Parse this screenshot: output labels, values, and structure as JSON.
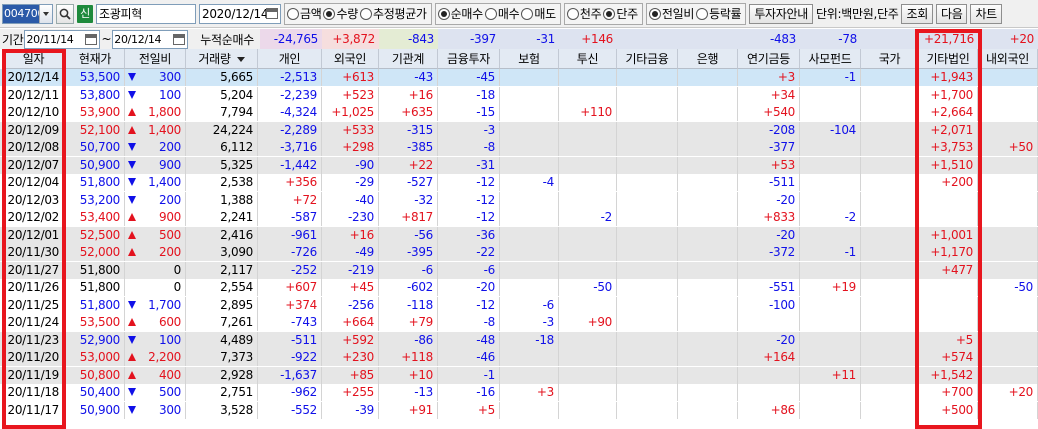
{
  "toolbar": {
    "stock_code": "004700",
    "market_badge": "신",
    "stock_name": "조광피혁",
    "date": "2020/12/14",
    "value_type": {
      "options": [
        "금액",
        "수량",
        "추정평균가"
      ],
      "selected": "수량"
    },
    "trade_type": {
      "options": [
        "순매수",
        "매수",
        "매도"
      ],
      "selected": "순매수"
    },
    "price_unit": {
      "options": [
        "천주",
        "단주"
      ],
      "selected": "단주"
    },
    "compare": {
      "options": [
        "전일비",
        "등락률"
      ],
      "selected": "전일비"
    },
    "investor_guide_label": "투자자안내",
    "unit_text": "단위:백만원,단주",
    "search_label": "조회",
    "next_label": "다음",
    "chart_label": "차트"
  },
  "filter": {
    "period_label": "기간",
    "from_date": "20/11/14",
    "tilde": "~",
    "to_date": "20/12/14",
    "cumulative_label": "누적순매수"
  },
  "cumulative": [
    "-24,765",
    "+3,872",
    "-843",
    "-397",
    "-31",
    "+146",
    "",
    "",
    "-483",
    "-78",
    "",
    "+21,716",
    "+20"
  ],
  "headers": [
    "일자",
    "현재가",
    "전일비",
    "거래량",
    "개인",
    "외국인",
    "기관계",
    "금융투자",
    "보험",
    "투신",
    "기타금융",
    "은행",
    "연기금등",
    "사모펀드",
    "국가",
    "기타법인",
    "내외국인"
  ],
  "rows": [
    {
      "date": "20/12/14",
      "price": "53,500",
      "dir": "down",
      "change": "300",
      "volume": "5,665",
      "vals": [
        "-2,513",
        "+613",
        "-43",
        "-45",
        "",
        "",
        "",
        "",
        "+3",
        "-1",
        "",
        "+1,943",
        ""
      ]
    },
    {
      "date": "20/12/11",
      "price": "53,800",
      "dir": "down",
      "change": "100",
      "volume": "5,204",
      "vals": [
        "-2,239",
        "+523",
        "+16",
        "-18",
        "",
        "",
        "",
        "",
        "+34",
        "",
        "",
        "+1,700",
        ""
      ]
    },
    {
      "date": "20/12/10",
      "price": "53,900",
      "dir": "up",
      "change": "1,800",
      "volume": "7,794",
      "vals": [
        "-4,324",
        "+1,025",
        "+635",
        "-15",
        "",
        "+110",
        "",
        "",
        "+540",
        "",
        "",
        "+2,664",
        ""
      ]
    },
    {
      "date": "20/12/09",
      "price": "52,100",
      "dir": "up",
      "change": "1,400",
      "volume": "24,224",
      "vals": [
        "-2,289",
        "+533",
        "-315",
        "-3",
        "",
        "",
        "",
        "",
        "-208",
        "-104",
        "",
        "+2,071",
        ""
      ]
    },
    {
      "date": "20/12/08",
      "price": "50,700",
      "dir": "down",
      "change": "200",
      "volume": "6,112",
      "vals": [
        "-3,716",
        "+298",
        "-385",
        "-8",
        "",
        "",
        "",
        "",
        "-377",
        "",
        "",
        "+3,753",
        "+50"
      ]
    },
    {
      "date": "20/12/07",
      "price": "50,900",
      "dir": "down",
      "change": "900",
      "volume": "5,325",
      "vals": [
        "-1,442",
        "-90",
        "+22",
        "-31",
        "",
        "",
        "",
        "",
        "+53",
        "",
        "",
        "+1,510",
        ""
      ]
    },
    {
      "date": "20/12/04",
      "price": "51,800",
      "dir": "down",
      "change": "1,400",
      "volume": "2,538",
      "vals": [
        "+356",
        "-29",
        "-527",
        "-12",
        "-4",
        "",
        "",
        "",
        "-511",
        "",
        "",
        "+200",
        ""
      ]
    },
    {
      "date": "20/12/03",
      "price": "53,200",
      "dir": "down",
      "change": "200",
      "volume": "1,388",
      "vals": [
        "+72",
        "-40",
        "-32",
        "-12",
        "",
        "",
        "",
        "",
        "-20",
        "",
        "",
        "",
        ""
      ]
    },
    {
      "date": "20/12/02",
      "price": "53,400",
      "dir": "up",
      "change": "900",
      "volume": "2,241",
      "vals": [
        "-587",
        "-230",
        "+817",
        "-12",
        "",
        "-2",
        "",
        "",
        "+833",
        "-2",
        "",
        "",
        ""
      ]
    },
    {
      "date": "20/12/01",
      "price": "52,500",
      "dir": "up",
      "change": "500",
      "volume": "2,416",
      "vals": [
        "-961",
        "+16",
        "-56",
        "-36",
        "",
        "",
        "",
        "",
        "-20",
        "",
        "",
        "+1,001",
        ""
      ]
    },
    {
      "date": "20/11/30",
      "price": "52,000",
      "dir": "up",
      "change": "200",
      "volume": "3,090",
      "vals": [
        "-726",
        "-49",
        "-395",
        "-22",
        "",
        "",
        "",
        "",
        "-372",
        "-1",
        "",
        "+1,170",
        ""
      ]
    },
    {
      "date": "20/11/27",
      "price": "51,800",
      "dir": "",
      "change": "0",
      "volume": "2,117",
      "vals": [
        "-252",
        "-219",
        "-6",
        "-6",
        "",
        "",
        "",
        "",
        "",
        "",
        "",
        "+477",
        ""
      ]
    },
    {
      "date": "20/11/26",
      "price": "51,800",
      "dir": "",
      "change": "0",
      "volume": "2,554",
      "vals": [
        "+607",
        "+45",
        "-602",
        "-20",
        "",
        "-50",
        "",
        "",
        "-551",
        "+19",
        "",
        "",
        "-50"
      ]
    },
    {
      "date": "20/11/25",
      "price": "51,800",
      "dir": "down",
      "change": "1,700",
      "volume": "2,895",
      "vals": [
        "+374",
        "-256",
        "-118",
        "-12",
        "-6",
        "",
        "",
        "",
        "-100",
        "",
        "",
        "",
        ""
      ]
    },
    {
      "date": "20/11/24",
      "price": "53,500",
      "dir": "up",
      "change": "600",
      "volume": "7,261",
      "vals": [
        "-743",
        "+664",
        "+79",
        "-8",
        "-3",
        "+90",
        "",
        "",
        "",
        "",
        "",
        "",
        ""
      ]
    },
    {
      "date": "20/11/23",
      "price": "52,900",
      "dir": "down",
      "change": "100",
      "volume": "4,489",
      "vals": [
        "-511",
        "+592",
        "-86",
        "-48",
        "-18",
        "",
        "",
        "",
        "-20",
        "",
        "",
        "+5",
        ""
      ]
    },
    {
      "date": "20/11/20",
      "price": "53,000",
      "dir": "up",
      "change": "2,200",
      "volume": "7,373",
      "vals": [
        "-922",
        "+230",
        "+118",
        "-46",
        "",
        "",
        "",
        "",
        "+164",
        "",
        "",
        "+574",
        ""
      ]
    },
    {
      "date": "20/11/19",
      "price": "50,800",
      "dir": "up",
      "change": "400",
      "volume": "2,928",
      "vals": [
        "-1,637",
        "+85",
        "+10",
        "-1",
        "",
        "",
        "",
        "",
        "",
        "+11",
        "",
        "+1,542",
        ""
      ]
    },
    {
      "date": "20/11/18",
      "price": "50,400",
      "dir": "down",
      "change": "500",
      "volume": "2,751",
      "vals": [
        "-962",
        "+255",
        "-13",
        "-16",
        "+3",
        "",
        "",
        "",
        "",
        "",
        "",
        "+700",
        "+20"
      ]
    },
    {
      "date": "20/11/17",
      "price": "50,900",
      "dir": "down",
      "change": "300",
      "volume": "3,528",
      "vals": [
        "-552",
        "-39",
        "+91",
        "+5",
        "",
        "",
        "",
        "",
        "+86",
        "",
        "",
        "+500",
        ""
      ]
    }
  ],
  "colors": {
    "up": "#e3121e",
    "down": "#1010e8",
    "highlight": "#e8161e",
    "selected_row": "#cfe6f7",
    "gray_row": "#e6e6e6"
  }
}
